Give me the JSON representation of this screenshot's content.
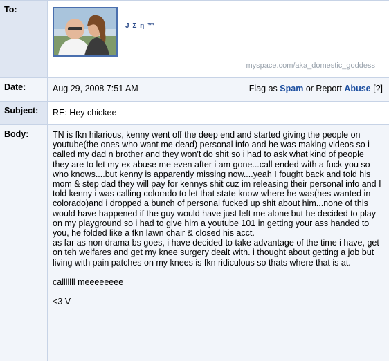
{
  "labels": {
    "to": "To:",
    "date": "Date:",
    "subject": "Subject:",
    "body": "Body:"
  },
  "sender": {
    "name": "J Σ η ™",
    "url": "myspace.com/aka_domestic_goddess"
  },
  "date": "Aug 29, 2008 7:51 AM",
  "flag": {
    "prefix": "Flag as",
    "spam": "Spam",
    "or": "or Report",
    "abuse": "Abuse",
    "help": "[?]"
  },
  "subject": "RE: Hey chickee",
  "body": {
    "paragraphs": [
      "TN is fkn hilarious, kenny went off the deep end and started giving the people on youtube(the ones who want me dead) personal info and he was making videos so i called my dad n brother and they won't do shit so i had to ask what kind of people they are to let my ex abuse me even after i am gone...call ended with a fuck you so who knows....but kenny is apparently missing now....yeah I fought back and told his mom & step dad they will pay for kennys shit cuz im releasing their personal info and I told kenny i was calling colorado to let that state know where he was(hes wanted in colorado)and i dropped a bunch of personal fucked up shit about him...none of this would have happened if the guy would have just left me alone but he decided to play on my playground so i had to give him a youtube 101 in getting your ass handed to you, he folded like a fkn lawn chair & closed his acct.\nas far as non drama bs goes, i have decided to take advantage of the time i have, get on teh welfares and get my knee surgery dealt with. i thought about getting a job but living with pain patches on my knees is fkn ridiculous so thats where that is at.",
      "calllllll meeeeeeee",
      "<3 V"
    ]
  },
  "colors": {
    "label_bg": "#dfe6f2",
    "border": "#c7d3e6",
    "link": "#1d4fa0",
    "url_gray": "#9aa3ad"
  }
}
